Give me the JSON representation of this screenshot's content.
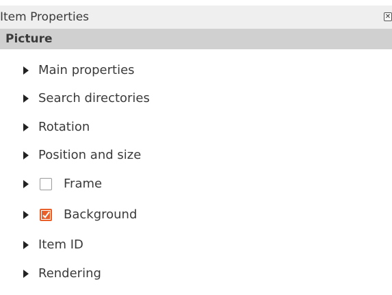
{
  "window": {
    "title": "Item Properties",
    "close_icon": "close-icon"
  },
  "section": {
    "label": "Picture"
  },
  "groups": [
    {
      "label": "Main properties",
      "has_checkbox": false
    },
    {
      "label": "Search directories",
      "has_checkbox": false
    },
    {
      "label": "Rotation",
      "has_checkbox": false
    },
    {
      "label": "Position and size",
      "has_checkbox": false
    },
    {
      "label": "Frame",
      "has_checkbox": true,
      "checked": false
    },
    {
      "label": "Background",
      "has_checkbox": true,
      "checked": true
    },
    {
      "label": "Item ID",
      "has_checkbox": false
    },
    {
      "label": "Rendering",
      "has_checkbox": false
    }
  ],
  "colors": {
    "checkbox_checked": "#e85f2a",
    "section_header_bg": "#d0d0d0"
  }
}
